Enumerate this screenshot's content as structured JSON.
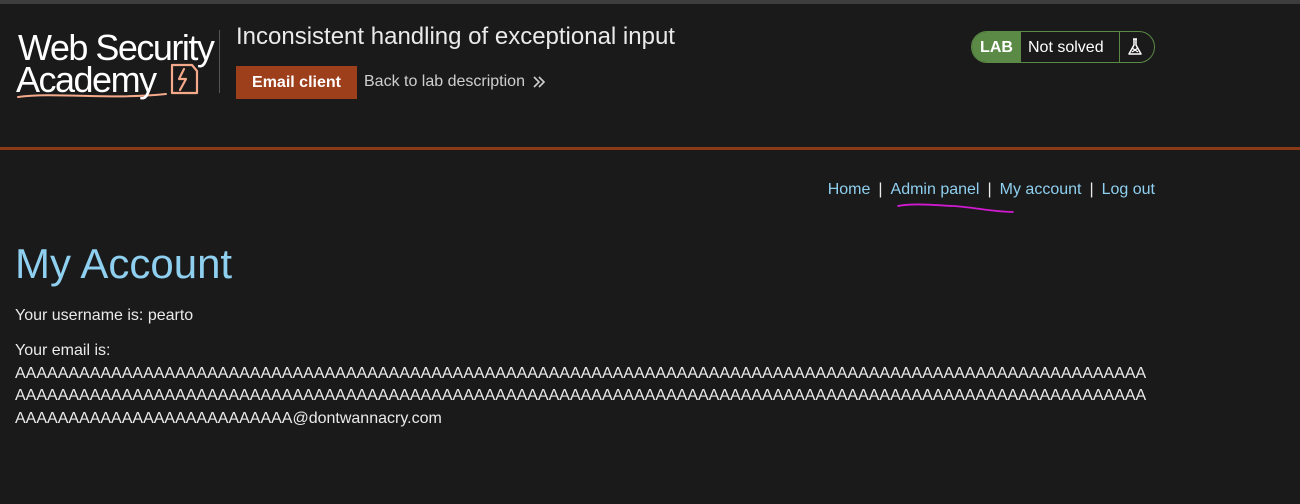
{
  "header": {
    "logo": {
      "line1": "Web Security",
      "line2": "Academy"
    },
    "lab_title": "Inconsistent handling of exceptional input",
    "email_client_label": "Email client",
    "back_link_label": "Back to lab description",
    "status": {
      "badge": "LAB",
      "text": "Not solved"
    }
  },
  "nav": {
    "items": [
      "Home",
      "Admin panel",
      "My account",
      "Log out"
    ],
    "separator": "|"
  },
  "main": {
    "title": "My Account",
    "username_label": "Your username is: pearto",
    "email_label": "Your email is:",
    "email_value": "AAAAAAAAAAAAAAAAAAAAAAAAAAAAAAAAAAAAAAAAAAAAAAAAAAAAAAAAAAAAAAAAAAAAAAAAAAAAAAAAAAAAAAAAAAAAAAAAAAAAAAAAAAAAAAAAAAAAAAAAAAAAAAAAAAAAAAAAAAAAAAAAAAAAAAAAAAAAAAAAAAAAAAAAAAAAAAAAAAAAAAAAAAAAAAAAAAAAAAAAAAAAAAAAAAAAAAAAAAAAAAAAAAAAAAAAAAAAAA@dontwannacry.com"
  },
  "colors": {
    "background": "#1a1a1a",
    "accent_orange": "#9e3f1c",
    "header_rule": "#8a3a16",
    "link_blue": "#8fcfef",
    "lab_green": "#5b8a46",
    "logo_accent": "#f4a98a",
    "annotation_magenta": "#d01ad0"
  },
  "icons": {
    "back": "double-chevron-right-icon",
    "status": "flask-icon",
    "logo": "lightning-bolt-icon"
  }
}
